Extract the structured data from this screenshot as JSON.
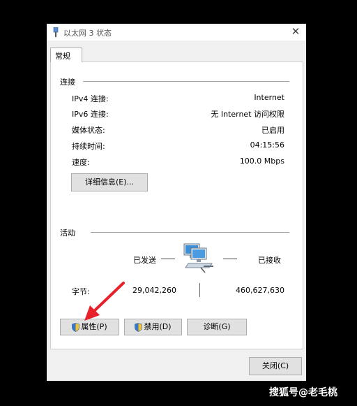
{
  "window": {
    "title": "以太网 3 状态",
    "close": "✕"
  },
  "tabs": [
    {
      "label": "常规"
    }
  ],
  "connection": {
    "group_label": "连接",
    "rows": [
      {
        "label": "IPv4 连接:",
        "value": "Internet"
      },
      {
        "label": "IPv6 连接:",
        "value": "无 Internet 访问权限"
      },
      {
        "label": "媒体状态:",
        "value": "已启用"
      },
      {
        "label": "持续时间:",
        "value": "04:15:56"
      },
      {
        "label": "速度:",
        "value": "100.0 Mbps"
      }
    ],
    "details_button": "详细信息(E)..."
  },
  "activity": {
    "group_label": "活动",
    "sent_label": "已发送",
    "received_label": "已接收",
    "bytes_label": "字节:",
    "bytes_sent": "29,042,260",
    "bytes_received": "460,627,630"
  },
  "buttons": {
    "properties": "属性(P)",
    "disable": "禁用(D)",
    "diagnose": "诊断(G)",
    "close": "关闭(C)"
  },
  "watermark": "搜狐号@老毛桃",
  "colors": {
    "arrow": "#e8202a",
    "network_screen": "#3c8fd6"
  }
}
